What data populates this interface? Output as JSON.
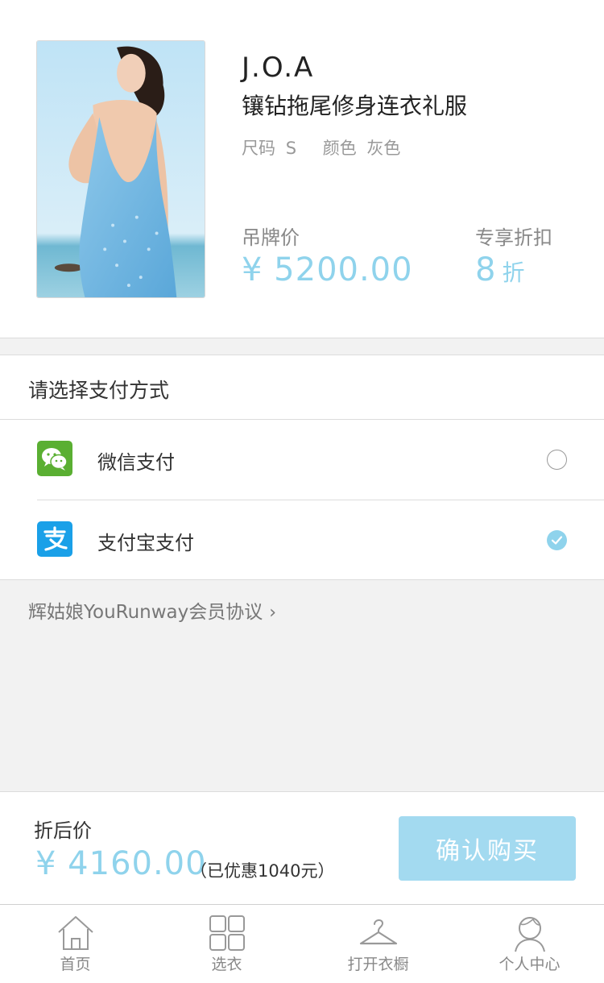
{
  "product": {
    "brand": "J.O.A",
    "name": "镶钻拖尾修身连衣礼服",
    "size_label": "尺码",
    "size_value": "S",
    "color_label": "颜色",
    "color_value": "灰色",
    "tag_price_label": "吊牌价",
    "tag_price": "¥ 5200.00",
    "discount_label": "专享折扣",
    "discount_value": "8",
    "discount_unit": "折"
  },
  "payment": {
    "title": "请选择支付方式",
    "methods": [
      {
        "label": "微信支付",
        "icon": "wechat-pay-icon",
        "selected": false
      },
      {
        "label": "支付宝支付",
        "icon": "alipay-icon",
        "selected": true
      }
    ]
  },
  "agreement": {
    "label": "辉姑娘YouRunway会员协议",
    "chevron": "›"
  },
  "checkout": {
    "final_label": "折后价",
    "final_price": "¥ 4160.00",
    "saved_text": "（已优惠1040元）",
    "buy_label": "确认购买"
  },
  "tabbar": {
    "items": [
      {
        "label": "首页",
        "icon": "home-icon"
      },
      {
        "label": "选衣",
        "icon": "grid-icon"
      },
      {
        "label": "打开衣橱",
        "icon": "hanger-icon"
      },
      {
        "label": "个人中心",
        "icon": "person-icon"
      }
    ]
  },
  "colors": {
    "accent": "#8fd3ec",
    "button": "#a3daf0",
    "wechat_green": "#5aaf32",
    "alipay_blue": "#1aa0e8"
  }
}
